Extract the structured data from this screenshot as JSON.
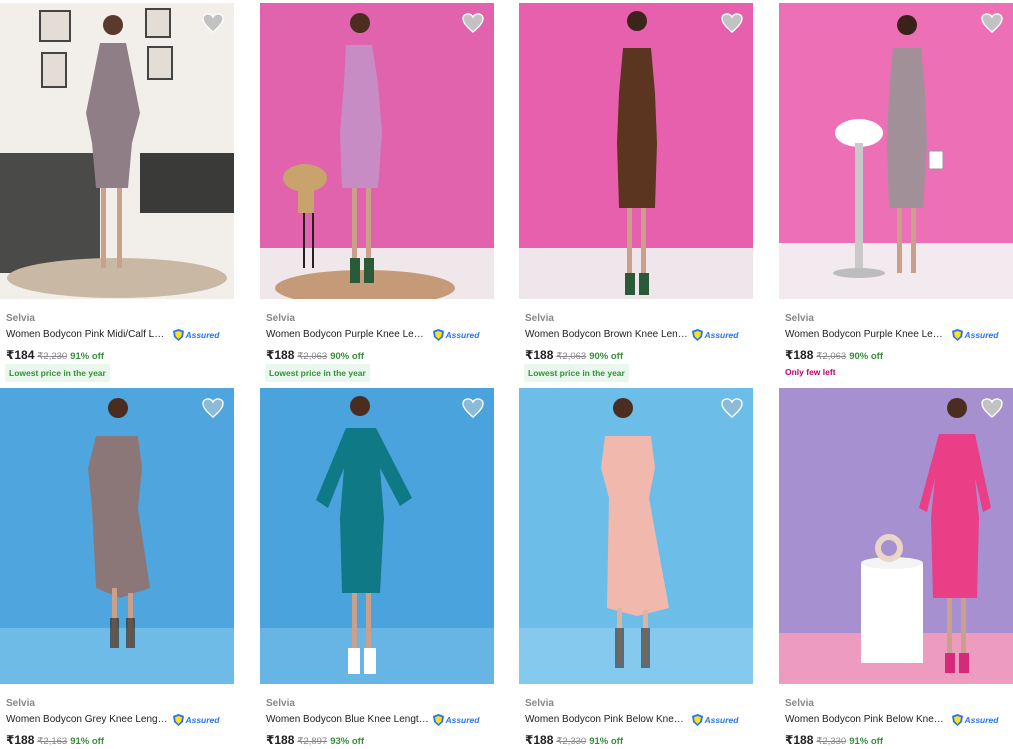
{
  "colors": {
    "offer_green": "#388e3c",
    "assured_blue": "#2874f0",
    "stock_pink": "#c20068",
    "mrp_grey": "#878787"
  },
  "icons": {
    "wishlist": "heart-icon",
    "assured": "shield-icon"
  },
  "products": [
    {
      "brand": "Selvia",
      "title": "Women Bodycon Pink Midi/Calf Length Dress",
      "assured": "Assured",
      "price": "₹184",
      "mrp": "₹2,230",
      "discount": "91% off",
      "tag": "Lowest price in the year",
      "dress_color": "#8f7e85"
    },
    {
      "brand": "Selvia",
      "title": "Women Bodycon Purple Knee Length Dress",
      "assured": "Assured",
      "price": "₹188",
      "mrp": "₹2,063",
      "discount": "90% off",
      "tag": "Lowest price in the year",
      "dress_color": "#c88cc4"
    },
    {
      "brand": "Selvia",
      "title": "Women Bodycon Brown Knee Length Dress",
      "assured": "Assured",
      "price": "₹188",
      "mrp": "₹2,063",
      "discount": "90% off",
      "tag": "Lowest price in the year",
      "dress_color": "#5b3520"
    },
    {
      "brand": "Selvia",
      "title": "Women Bodycon Purple Knee Length Dress",
      "assured": "Assured",
      "price": "₹188",
      "mrp": "₹2,063",
      "discount": "90% off",
      "stock": "Only few left",
      "dress_color": "#a19098"
    },
    {
      "brand": "Selvia",
      "title": "Women Bodycon Grey Knee Length Dress",
      "assured": "Assured",
      "price": "₹188",
      "mrp": "₹2,163",
      "discount": "91% off",
      "dress_color": "#8c7778"
    },
    {
      "brand": "Selvia",
      "title": "Women Bodycon Blue Knee Length Dress",
      "assured": "Assured",
      "price": "₹188",
      "mrp": "₹2,897",
      "discount": "93% off",
      "dress_color": "#0f7a85"
    },
    {
      "brand": "Selvia",
      "title": "Women Bodycon Pink Below Knee Dress",
      "assured": "Assured",
      "price": "₹188",
      "mrp": "₹2,330",
      "discount": "91% off",
      "dress_color": "#f1b9ad"
    },
    {
      "brand": "Selvia",
      "title": "Women Bodycon Pink Below Knee Dress",
      "assured": "Assured",
      "price": "₹188",
      "mrp": "₹2,330",
      "discount": "91% off",
      "dress_color": "#ea3f86"
    }
  ]
}
